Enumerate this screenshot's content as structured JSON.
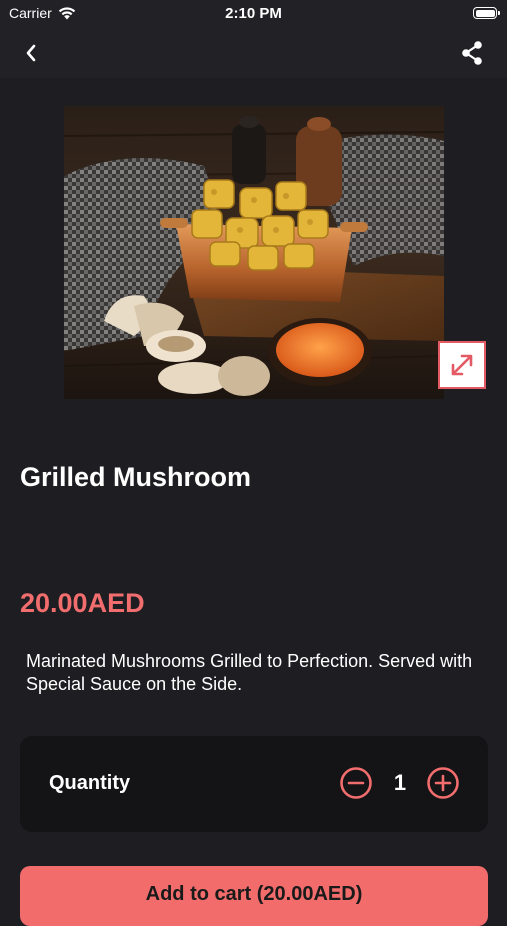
{
  "status_bar": {
    "carrier": "Carrier",
    "time": "2:10 PM",
    "wifi_icon": "wifi-icon",
    "battery_icon": "battery-icon"
  },
  "nav": {
    "back_icon": "chevron-left-icon",
    "share_icon": "share-icon"
  },
  "product": {
    "image_alt": "grilled-mushroom-photo",
    "expand_icon": "expand-icon",
    "title": "Grilled Mushroom",
    "price": "20.00AED",
    "description": "Marinated Mushrooms Grilled to Perfection. Served with Special Sauce on the Side."
  },
  "quantity": {
    "label": "Quantity",
    "value": "1",
    "minus_icon": "minus-circle-icon",
    "plus_icon": "plus-circle-icon"
  },
  "cart": {
    "label": "Add to cart (20.00AED)"
  },
  "colors": {
    "background": "#1e1e22",
    "accent": "#f26d6d",
    "card": "#141416"
  }
}
